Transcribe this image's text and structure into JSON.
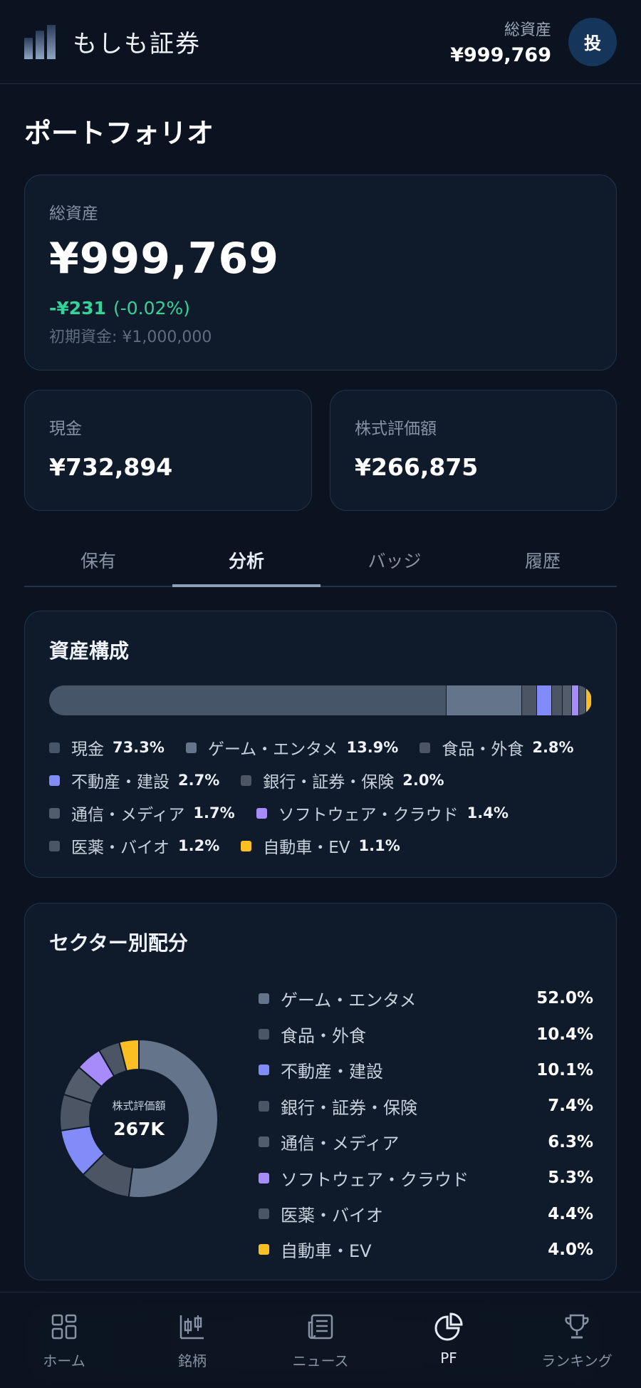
{
  "header": {
    "app_title": "もしも証券",
    "total_label": "総資産",
    "total_value": "¥999,769",
    "avatar_text": "投"
  },
  "page_title": "ポートフォリオ",
  "summary": {
    "total_label": "総資産",
    "total_value": "¥999,769",
    "change_amount": "-¥231",
    "change_pct": "(-0.02%)",
    "initial_label": "初期資金: ¥1,000,000",
    "cash_label": "現金",
    "cash_value": "¥732,894",
    "stock_label": "株式評価額",
    "stock_value": "¥266,875",
    "change_color": "#34d399"
  },
  "tabs": [
    {
      "label": "保有",
      "active": false
    },
    {
      "label": "分析",
      "active": true
    },
    {
      "label": "バッジ",
      "active": false
    },
    {
      "label": "履歴",
      "active": false
    }
  ],
  "composition": {
    "title": "資産構成",
    "items": [
      {
        "name": "現金",
        "pct": "73.3%",
        "value": 73.3,
        "color": "#475569"
      },
      {
        "name": "ゲーム・エンタメ",
        "pct": "13.9%",
        "value": 13.9,
        "color": "#64748b"
      },
      {
        "name": "食品・外食",
        "pct": "2.8%",
        "value": 2.8,
        "color": "#4b5563"
      },
      {
        "name": "不動産・建設",
        "pct": "2.7%",
        "value": 2.7,
        "color": "#818cf8"
      },
      {
        "name": "銀行・証券・保険",
        "pct": "2.0%",
        "value": 2.0,
        "color": "#4b5563"
      },
      {
        "name": "通信・メディア",
        "pct": "1.7%",
        "value": 1.7,
        "color": "#525c6b"
      },
      {
        "name": "ソフトウェア・クラウド",
        "pct": "1.4%",
        "value": 1.4,
        "color": "#a78bfa"
      },
      {
        "name": "医薬・バイオ",
        "pct": "1.2%",
        "value": 1.2,
        "color": "#4b5563"
      },
      {
        "name": "自動車・EV",
        "pct": "1.1%",
        "value": 1.1,
        "color": "#fbbf24"
      }
    ]
  },
  "sector": {
    "title": "セクター別配分",
    "center_label": "株式評価額",
    "center_value": "267K",
    "items": [
      {
        "name": "ゲーム・エンタメ",
        "pct": "52.0%",
        "value": 52.0,
        "color": "#64748b"
      },
      {
        "name": "食品・外食",
        "pct": "10.4%",
        "value": 10.4,
        "color": "#4b5563"
      },
      {
        "name": "不動産・建設",
        "pct": "10.1%",
        "value": 10.1,
        "color": "#818cf8"
      },
      {
        "name": "銀行・証券・保険",
        "pct": "7.4%",
        "value": 7.4,
        "color": "#4b5563"
      },
      {
        "name": "通信・メディア",
        "pct": "6.3%",
        "value": 6.3,
        "color": "#525c6b"
      },
      {
        "name": "ソフトウェア・クラウド",
        "pct": "5.3%",
        "value": 5.3,
        "color": "#a78bfa"
      },
      {
        "name": "医薬・バイオ",
        "pct": "4.4%",
        "value": 4.4,
        "color": "#4b5563"
      },
      {
        "name": "自動車・EV",
        "pct": "4.0%",
        "value": 4.0,
        "color": "#fbbf24"
      }
    ]
  },
  "nav": [
    {
      "label": "ホーム",
      "icon": "home-grid-icon",
      "active": false
    },
    {
      "label": "銘柄",
      "icon": "candlestick-icon",
      "active": false
    },
    {
      "label": "ニュース",
      "icon": "newspaper-icon",
      "active": false
    },
    {
      "label": "PF",
      "icon": "pie-chart-icon",
      "active": true
    },
    {
      "label": "ランキング",
      "icon": "trophy-icon",
      "active": false
    }
  ]
}
